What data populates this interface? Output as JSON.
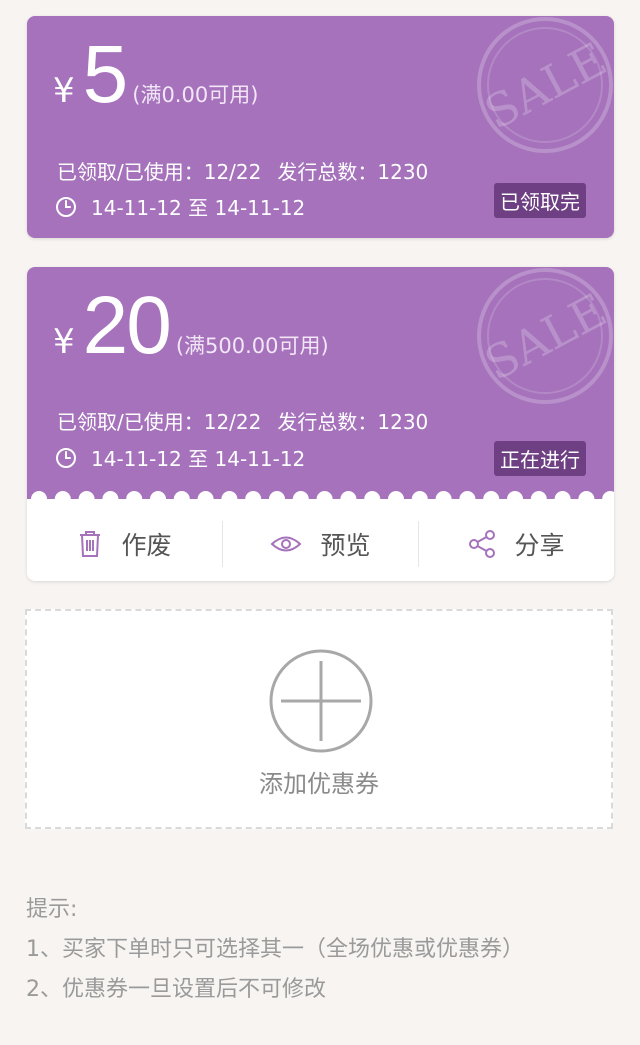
{
  "coupons": [
    {
      "currency": "¥",
      "amount": "5",
      "condition": "(满0.00可用)",
      "stats": "已领取/已使用：12/22",
      "issued": "发行总数：1230",
      "dates": "14-11-12 至 14-11-12",
      "status": "已领取完",
      "stamp_text": "SALE"
    },
    {
      "currency": "¥",
      "amount": "20",
      "condition": "(满500.00可用)",
      "stats": "已领取/已使用：12/22",
      "issued": "发行总数：1230",
      "dates": "14-11-12 至 14-11-12",
      "status": "正在进行",
      "stamp_text": "SALE"
    }
  ],
  "actions": {
    "void_label": "作废",
    "preview_label": "预览",
    "share_label": "分享"
  },
  "add": {
    "label": "添加优惠券"
  },
  "tips": {
    "title": "提示:",
    "line1": "1、买家下单时只可选择其一（全场优惠或优惠券）",
    "line2": "2、优惠券一旦设置后不可修改"
  },
  "colors": {
    "card": "#a572bb",
    "badge": "#6e3f82",
    "icon": "#a572bb",
    "background": "#f7f4f1"
  }
}
